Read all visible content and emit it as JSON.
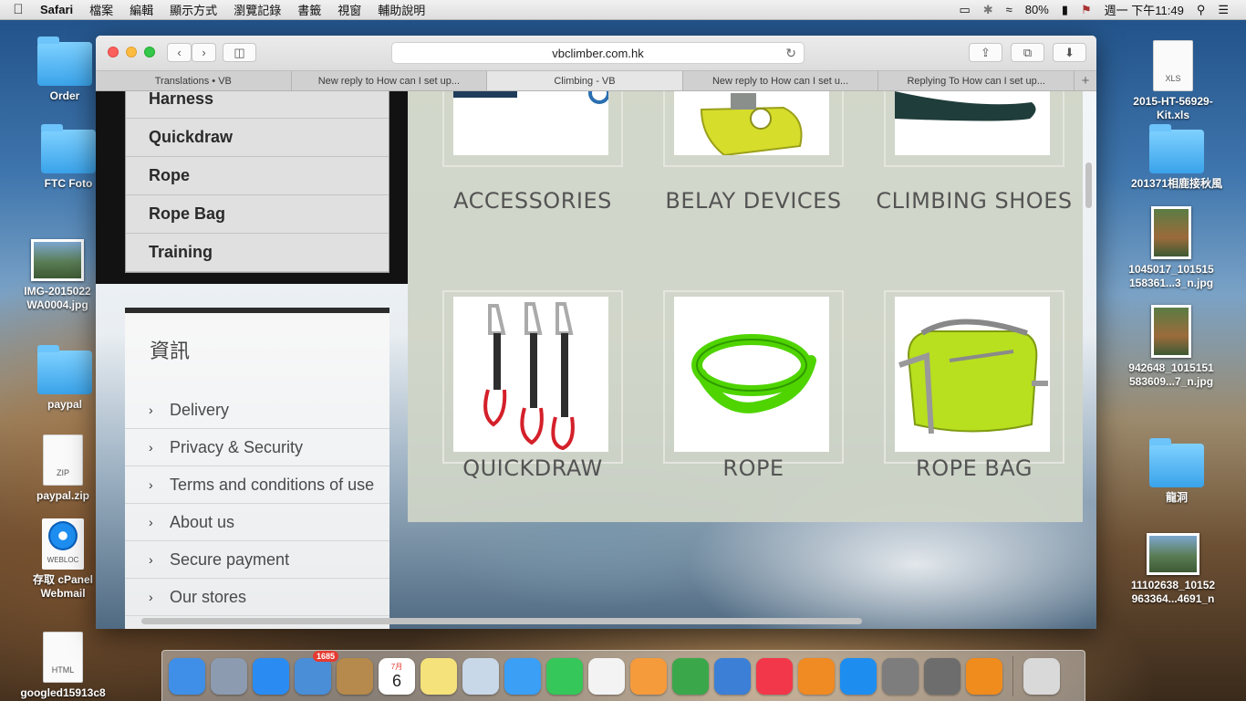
{
  "menubar": {
    "apple_icon": "",
    "app_name": "Safari",
    "items": [
      "檔案",
      "編輯",
      "顯示方式",
      "瀏覽記錄",
      "書籤",
      "視窗",
      "輔助說明"
    ],
    "battery": "80%",
    "datetime": "週一 下午11:49",
    "status_icons": [
      "airplay-icon",
      "bluetooth-icon",
      "wifi-icon",
      "battery-icon",
      "flag-us-icon",
      "spotlight-icon",
      "notification-center-icon"
    ]
  },
  "desktop": {
    "left_icons": [
      {
        "label": "Order",
        "kind": "folder"
      },
      {
        "label": "FTC Foto",
        "kind": "folder"
      },
      {
        "label": "IMG-2015022 WA0004.jpg",
        "kind": "photo"
      },
      {
        "label": "paypal",
        "kind": "folder"
      },
      {
        "label": "paypal.zip",
        "kind": "zip",
        "tag": "ZIP"
      },
      {
        "label": "存取 cPanel Webmail",
        "kind": "webloc",
        "tag": "WEBLOC"
      },
      {
        "label": "googled15913c8",
        "kind": "html",
        "tag": "HTML"
      }
    ],
    "right_icons": [
      {
        "label": "2015-HT-56929- Kit.xls",
        "kind": "xls",
        "tag": "XLS"
      },
      {
        "label": "201371相鹿接秋風",
        "kind": "folder"
      },
      {
        "label": "1045017_101515 158361...3_n.jpg",
        "kind": "photo-tall"
      },
      {
        "label": "942648_1015151 583609...7_n.jpg",
        "kind": "photo-tall"
      },
      {
        "label": "龍洞",
        "kind": "folder"
      },
      {
        "label": "11102638_10152 963364...4691_n",
        "kind": "photo"
      }
    ]
  },
  "safari": {
    "url": "vbclimber.com.hk",
    "tabs": [
      {
        "label": "Translations • VB",
        "active": false
      },
      {
        "label": "New reply to How can I set up...",
        "active": false
      },
      {
        "label": "Climbing - VB",
        "active": true
      },
      {
        "label": "New reply to How can I set u...",
        "active": false
      },
      {
        "label": "Replying To How can I set up...",
        "active": false
      }
    ],
    "new_tab_symbol": "+"
  },
  "page": {
    "category_menu": [
      "Harness",
      "Quickdraw",
      "Rope",
      "Rope Bag",
      "Training"
    ],
    "info": {
      "title": "資訊",
      "links": [
        "Delivery",
        "Privacy & Security",
        "Terms and conditions of use",
        "About us",
        "Secure payment",
        "Our stores"
      ]
    },
    "products": [
      {
        "name": "ACCESSORIES"
      },
      {
        "name": "BELAY DEVICES"
      },
      {
        "name": "CLIMBING SHOES"
      },
      {
        "name": "QUICKDRAW"
      },
      {
        "name": "ROPE"
      },
      {
        "name": "ROPE BAG"
      }
    ]
  },
  "dock": {
    "apps": [
      {
        "name": "finder-icon",
        "color": "#3f8fe8"
      },
      {
        "name": "launchpad-icon",
        "color": "#8c9bb0"
      },
      {
        "name": "safari-icon",
        "color": "#2a8cf2"
      },
      {
        "name": "mail-icon",
        "color": "#4a8ed8",
        "badge": "1685"
      },
      {
        "name": "contacts-icon",
        "color": "#b58a4c"
      },
      {
        "name": "calendar-icon",
        "color": "#ffffff",
        "text": "6",
        "month": "7月"
      },
      {
        "name": "notes-icon",
        "color": "#f6e27a"
      },
      {
        "name": "preview-icon",
        "color": "#c9d8e8"
      },
      {
        "name": "messages-icon",
        "color": "#3a9ff5"
      },
      {
        "name": "facetime-icon",
        "color": "#35c759"
      },
      {
        "name": "photos-icon",
        "color": "#f3f3f3"
      },
      {
        "name": "pages-icon",
        "color": "#f59b3c"
      },
      {
        "name": "numbers-icon",
        "color": "#3aa84a"
      },
      {
        "name": "keynote-icon",
        "color": "#3b7fd6"
      },
      {
        "name": "itunes-icon",
        "color": "#f3374b"
      },
      {
        "name": "ibooks-icon",
        "color": "#f08a22"
      },
      {
        "name": "app-store-icon",
        "color": "#1d8ef0"
      },
      {
        "name": "calculator-icon",
        "color": "#7d7d7d"
      },
      {
        "name": "system-preferences-icon",
        "color": "#6d6d6d"
      },
      {
        "name": "vlc-icon",
        "color": "#f08c1d"
      }
    ],
    "trash": {
      "name": "trash-icon",
      "color": "#d9d9d9"
    }
  }
}
